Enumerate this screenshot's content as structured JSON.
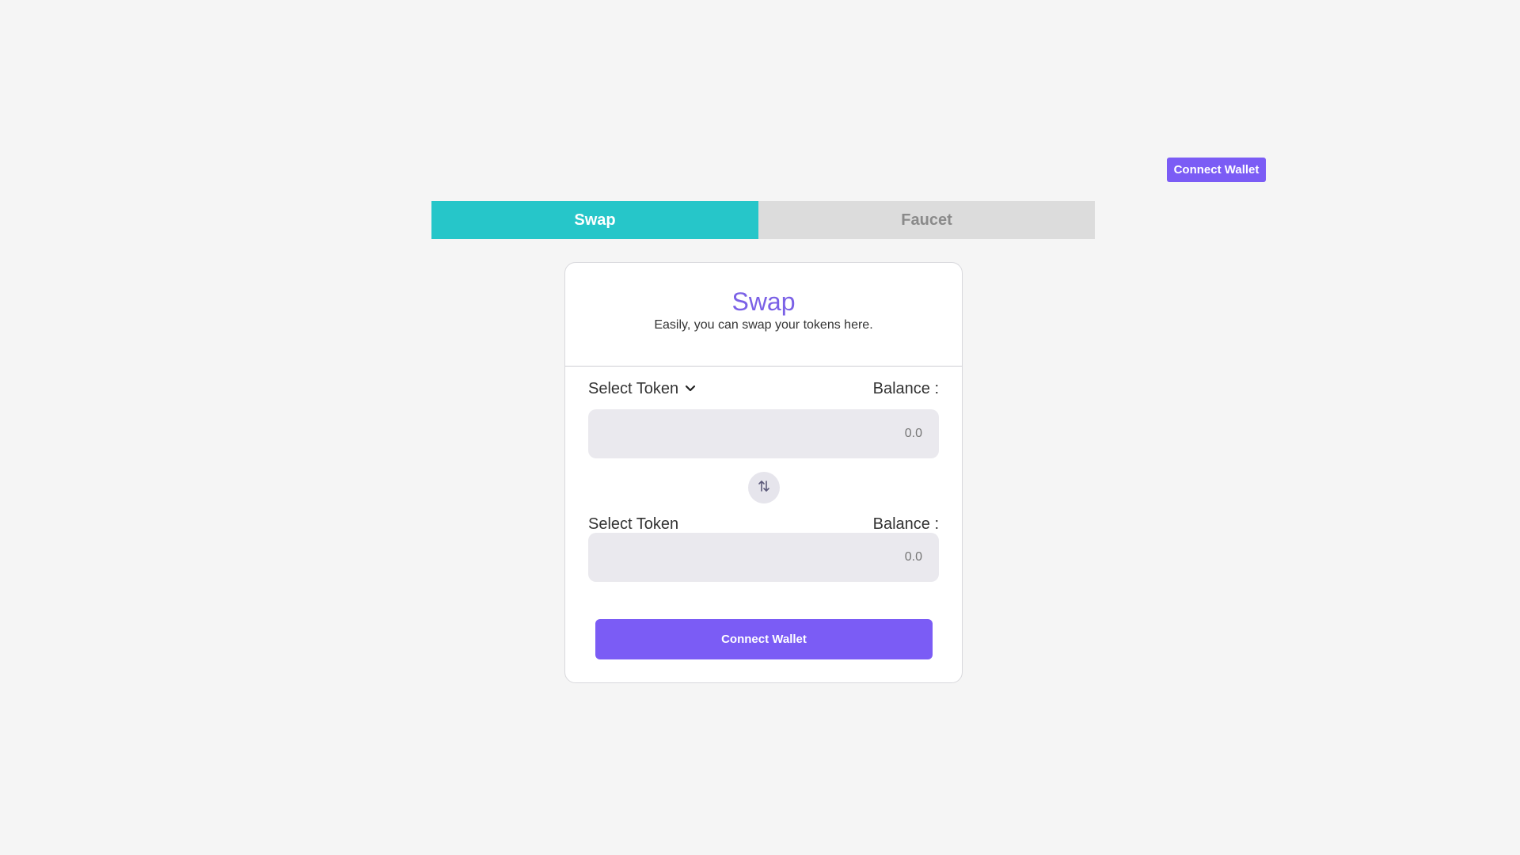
{
  "header": {
    "connect_wallet_label": "Connect Wallet"
  },
  "tabs": [
    {
      "label": "Swap",
      "active": true
    },
    {
      "label": "Faucet",
      "active": false
    }
  ],
  "card": {
    "title": "Swap",
    "subtitle": "Easily, you can swap your tokens here.",
    "from": {
      "select_label": "Select Token",
      "balance_label": "Balance :",
      "amount_placeholder": "0.0"
    },
    "to": {
      "select_label": "Select Token",
      "balance_label": "Balance :",
      "amount_placeholder": "0.0"
    },
    "swap_icon": "swap-vertical-arrows-icon",
    "connect_wallet_label": "Connect Wallet"
  },
  "colors": {
    "accent_purple": "#7b5cf5",
    "title_purple": "#7b61e6",
    "tab_active": "#26c6c9",
    "tab_inactive": "#dcdcdc",
    "background": "#f5f5f5",
    "input_background": "#eae9ee"
  }
}
